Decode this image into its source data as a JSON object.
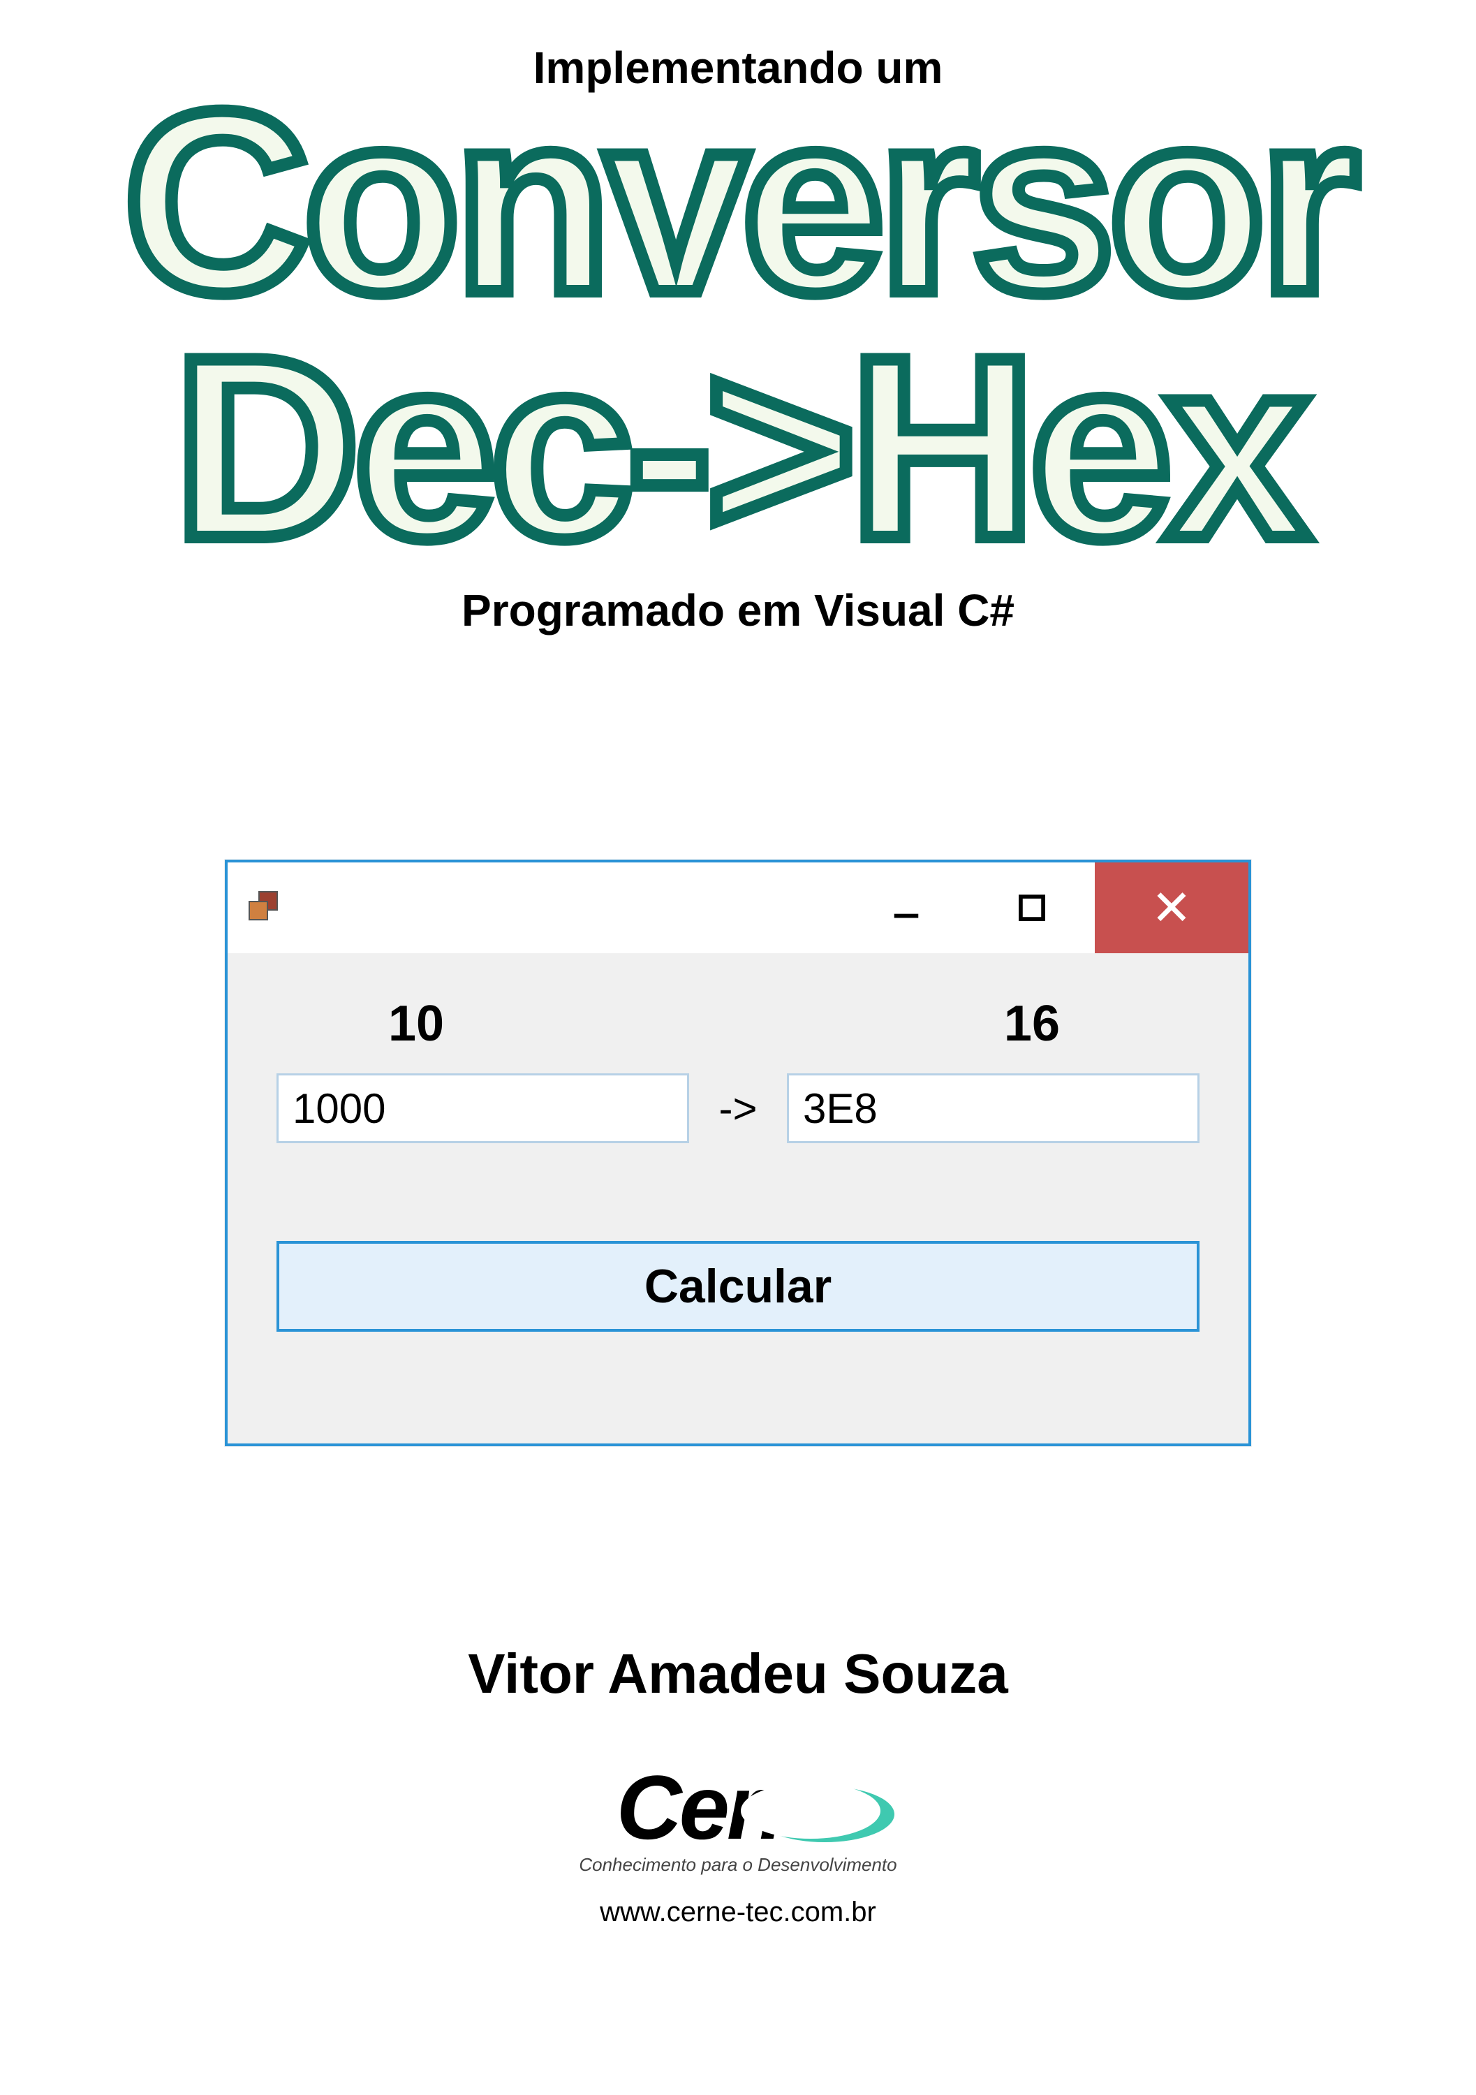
{
  "pretitle": "Implementando um",
  "title_line1": "Conversor",
  "title_line2": "Dec->Hex",
  "subtitle": "Programado em Visual C#",
  "form": {
    "label_left": "10",
    "label_right": "16",
    "input_value": "1000",
    "arrow": "->",
    "output_value": "3E8",
    "button": "Calcular"
  },
  "author": "Vitor Amadeu Souza",
  "brand": {
    "name": "Cerne",
    "tagline": "Conhecimento para o Desenvolvimento",
    "url": "www.cerne-tec.com.br"
  }
}
